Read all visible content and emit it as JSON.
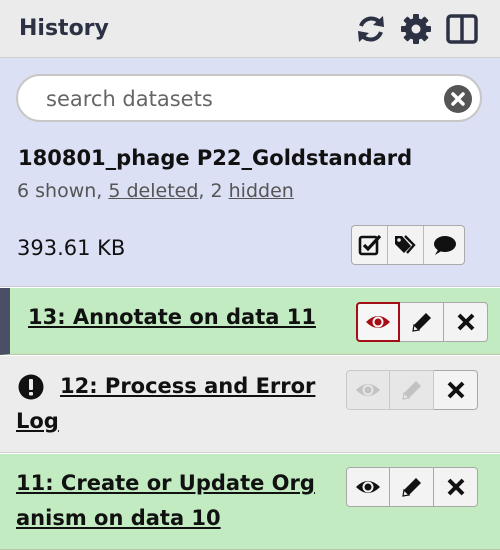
{
  "header": {
    "title": "History",
    "icons": [
      "refresh-icon",
      "gear-icon",
      "columns-icon"
    ]
  },
  "search": {
    "placeholder": "search datasets",
    "value": ""
  },
  "history": {
    "name": "180801_phage P22_Goldstandard",
    "shown": "6 shown, ",
    "deleted": "5 deleted",
    "sep": ", 2 ",
    "hidden": "hidden",
    "size": "393.61 KB"
  },
  "datasets": [
    {
      "hid_title": "13: Annotate on data 11",
      "state": "ok",
      "color": "#c2ebc1"
    },
    {
      "hid_title": "12: Process and Error Log",
      "state": "error",
      "color": "#ececec"
    },
    {
      "hid_title": "11: Create or Update Organism on data 10",
      "line1": "11: Create or Update Org",
      "line2": "anism on data 10",
      "state": "ok",
      "color": "#c2ebc1"
    }
  ],
  "colors": {
    "header_bg": "#ebebeb",
    "summary_bg": "#dbe0f4",
    "ok_bg": "#c2ebc1",
    "active_eye": "#a50e16",
    "current_marker": "#4a4f66"
  }
}
